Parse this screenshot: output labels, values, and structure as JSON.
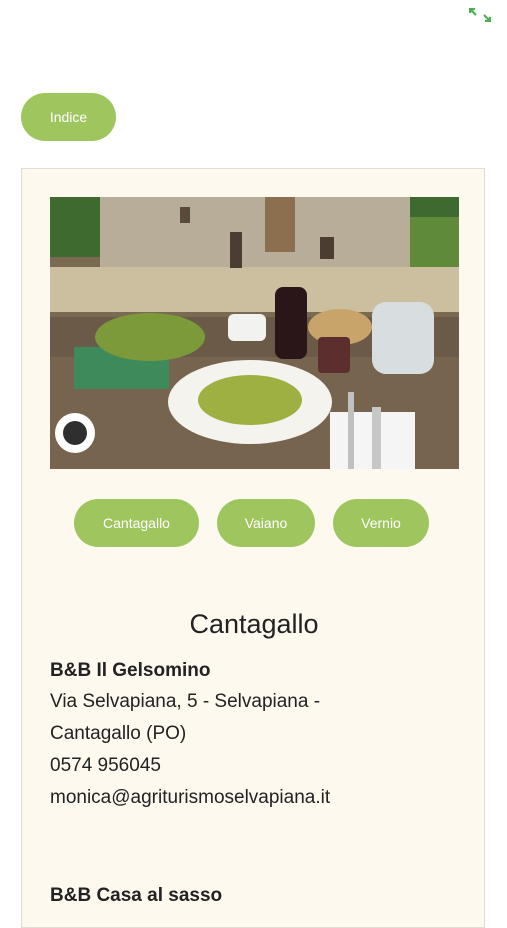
{
  "header": {
    "expand_icon": "expand-arrows-icon"
  },
  "nav": {
    "index_label": "Indice"
  },
  "colors": {
    "accent": "#9fc55f",
    "card_bg": "#fdf9ef"
  },
  "towns": [
    {
      "label": "Cantagallo"
    },
    {
      "label": "Vaiano"
    },
    {
      "label": "Vernio"
    }
  ],
  "section": {
    "title": "Cantagallo",
    "listings": [
      {
        "name": "B&B Il Gelsomino",
        "address_line1": "Via Selvapiana, 5 - Selvapiana -",
        "address_line2": "Cantagallo (PO)",
        "phone": "0574 956045",
        "email": "monica@agriturismoselvapiana.it"
      },
      {
        "name": "B&B Casa al sasso"
      }
    ]
  }
}
